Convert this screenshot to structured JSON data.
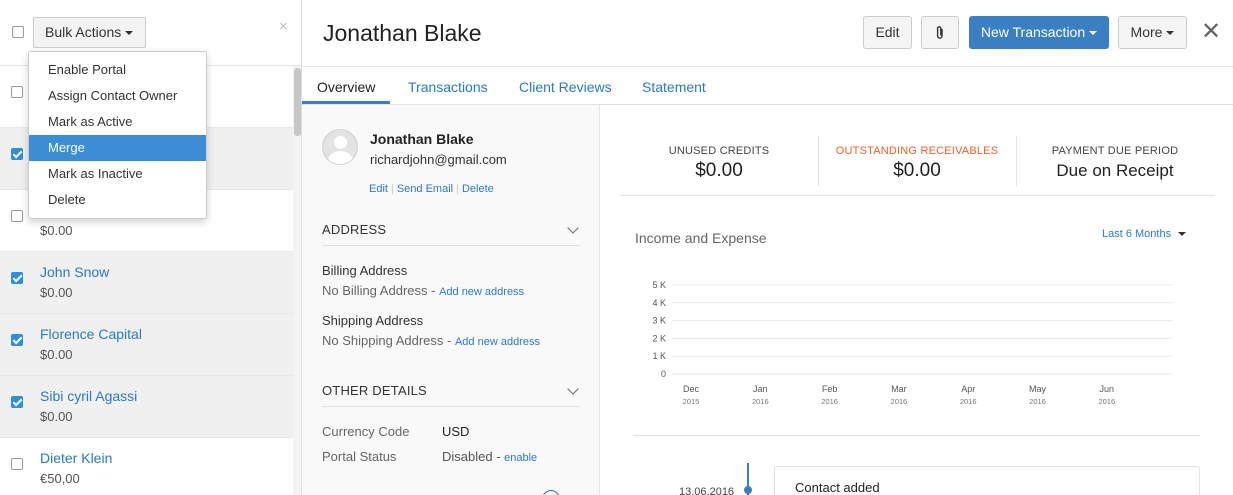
{
  "bulk": {
    "label": "Bulk Actions"
  },
  "menu": [
    {
      "label": "Enable Portal",
      "active": false
    },
    {
      "label": "Assign Contact Owner",
      "active": false
    },
    {
      "label": "Mark as Active",
      "active": false
    },
    {
      "label": "Merge",
      "active": true
    },
    {
      "label": "Mark as Inactive",
      "active": false
    },
    {
      "label": "Delete",
      "active": false
    }
  ],
  "list": [
    {
      "name": "",
      "amount": "",
      "checked": false,
      "selected": false
    },
    {
      "name": "",
      "amount": "",
      "checked": true,
      "selected": true
    },
    {
      "name": "",
      "amount": "$0.00",
      "checked": false,
      "selected": false
    },
    {
      "name": "John Snow",
      "amount": "$0.00",
      "checked": true,
      "selected": true
    },
    {
      "name": "Florence Capital",
      "amount": "$0.00",
      "checked": true,
      "selected": true
    },
    {
      "name": "Sibi cyril Agassi",
      "amount": "$0.00",
      "checked": true,
      "selected": true
    },
    {
      "name": "Dieter Klein",
      "amount": "€50,00",
      "checked": false,
      "selected": false
    }
  ],
  "header": {
    "title": "Jonathan Blake",
    "edit": "Edit",
    "new_transaction": "New Transaction",
    "more": "More"
  },
  "tabs": [
    "Overview",
    "Transactions",
    "Client Reviews",
    "Statement"
  ],
  "profile": {
    "name": "Jonathan Blake",
    "email": "richardjohn@gmail.com",
    "links": [
      "Edit",
      "Send Email",
      "Delete"
    ]
  },
  "address": {
    "heading": "ADDRESS",
    "billing_label": "Billing Address",
    "billing_value": "No Billing Address - ",
    "billing_link": "Add new address",
    "shipping_label": "Shipping Address",
    "shipping_value": "No Shipping Address - ",
    "shipping_link": "Add new address"
  },
  "other": {
    "heading": "OTHER DETAILS",
    "currency_label": "Currency Code",
    "currency_value": "USD",
    "portal_label": "Portal Status",
    "portal_value": "Disabled - ",
    "portal_link": "enable"
  },
  "stats": [
    {
      "label": "UNUSED CREDITS",
      "value": "$0.00",
      "color": "#444444"
    },
    {
      "label": "OUTSTANDING RECEIVABLES",
      "value": "$0.00",
      "color": "#e8632a"
    },
    {
      "label": "PAYMENT DUE PERIOD",
      "value": "Due on Receipt",
      "color": "#444444"
    }
  ],
  "chart": {
    "title": "Income and Expense",
    "range": "Last 6 Months"
  },
  "chart_data": {
    "type": "line",
    "categories": [
      "Dec 2015",
      "Jan 2016",
      "Feb 2016",
      "Mar 2016",
      "Apr 2016",
      "May 2016",
      "Jun 2016"
    ],
    "x_month_labels": [
      "Dec",
      "Jan",
      "Feb",
      "Mar",
      "Apr",
      "May",
      "Jun"
    ],
    "x_year_labels": [
      "2015",
      "2016",
      "2016",
      "2016",
      "2016",
      "2016",
      "2016"
    ],
    "y_ticks": [
      "0",
      "1 K",
      "2 K",
      "3 K",
      "4 K",
      "5 K"
    ],
    "ylim": [
      0,
      5000
    ],
    "series": [],
    "grid": true
  },
  "timeline": {
    "date": "13.06.2016",
    "event": "Contact added"
  }
}
